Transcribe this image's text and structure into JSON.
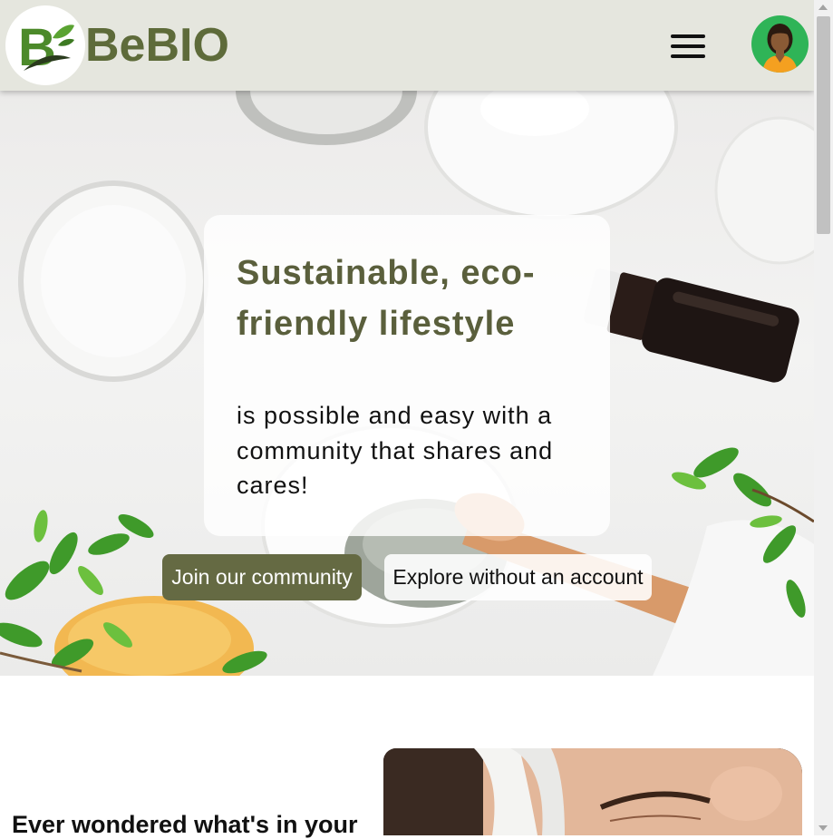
{
  "header": {
    "brand_name": "BeBIO",
    "logo_letter": "B",
    "logo_icon": "leaf-b-logo-icon",
    "menu_icon": "hamburger-menu-icon",
    "avatar_icon": "user-avatar-icon"
  },
  "hero": {
    "headline": "Sustainable, eco-friendly lifestyle",
    "subline": "is possible and easy with a community that shares and cares!",
    "primary_button": "Join our community",
    "secondary_button": "Explore without an account"
  },
  "section": {
    "heading": "Ever wondered what's in your"
  },
  "colors": {
    "brand": "#5e6b3a",
    "primary_button": "#656a43",
    "header_bg": "#e5e6de",
    "avatar_bg": "#2fb457"
  }
}
